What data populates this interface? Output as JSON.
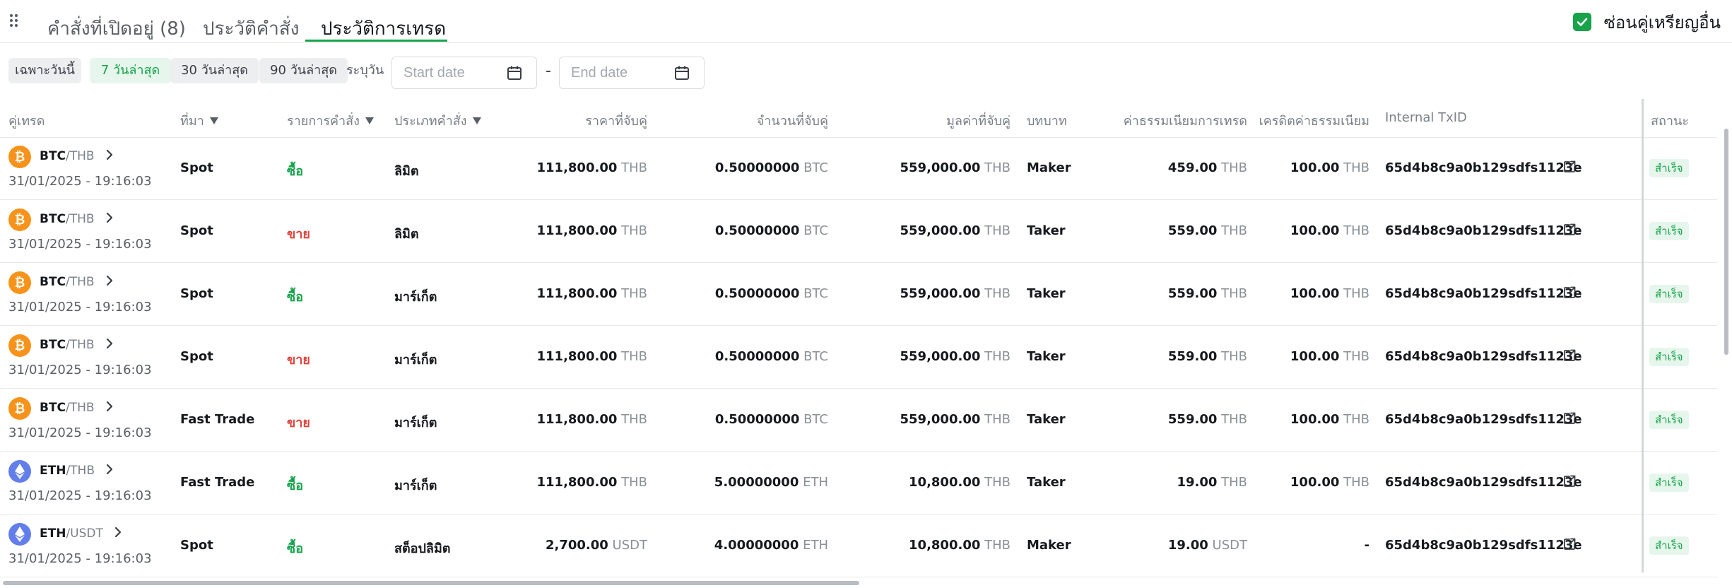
{
  "tabs": [
    {
      "label": "คำสั่งที่เปิดอยู่ (8)",
      "active": false
    },
    {
      "label": "ประวัติคำสั่ง",
      "active": false
    },
    {
      "label": "ประวัติการเทรด",
      "active": true
    }
  ],
  "hide_other_pairs": {
    "label": "ซ่อนคู่เหรียญอื่น",
    "checked": true
  },
  "filters": {
    "chips": [
      {
        "label": "เฉพาะวันนี้",
        "active": false
      },
      {
        "label": "7 วันล่าสุด",
        "active": true
      },
      {
        "label": "30 วันล่าสุด",
        "active": false
      },
      {
        "label": "90 วันล่าสุด",
        "active": false
      }
    ],
    "custom_label": "ระบุวัน",
    "start_placeholder": "Start date",
    "end_placeholder": "End date",
    "separator": "-"
  },
  "columns": {
    "pair": "คู่เทรด",
    "source": "ที่มา",
    "side": "รายการคำสั่ง",
    "type": "ประเภทคำสั่ง",
    "price": "ราคาที่จับคู่",
    "amount": "จำนวนที่จับคู่",
    "value": "มูลค่าที่จับคู่",
    "role": "บทบาท",
    "fee": "ค่าธรรมเนียมการเทรด",
    "fee_credit": "เครดิตค่าธรรมเนียม",
    "txid": "Internal TxID",
    "status": "สถานะ"
  },
  "rows": [
    {
      "coin": "btc",
      "base": "BTC",
      "quote": "/THB",
      "date": "31/01/2025 - 19:16:03",
      "source": "Spot",
      "side": "ซื้อ",
      "side_type": "buy",
      "order_type": "ลิมิต",
      "price": "111,800.00",
      "price_unit": "THB",
      "amount": "0.50000000",
      "amount_unit": "BTC",
      "value": "559,000.00",
      "value_unit": "THB",
      "role": "Maker",
      "fee": "459.00",
      "fee_unit": "THB",
      "credit": "100.00",
      "credit_unit": "THB",
      "txid": "65d4b8c9a0b129sdfs1123e",
      "status": "สำเร็จ"
    },
    {
      "coin": "btc",
      "base": "BTC",
      "quote": "/THB",
      "date": "31/01/2025 - 19:16:03",
      "source": "Spot",
      "side": "ขาย",
      "side_type": "sell",
      "order_type": "ลิมิต",
      "price": "111,800.00",
      "price_unit": "THB",
      "amount": "0.50000000",
      "amount_unit": "BTC",
      "value": "559,000.00",
      "value_unit": "THB",
      "role": "Taker",
      "fee": "559.00",
      "fee_unit": "THB",
      "credit": "100.00",
      "credit_unit": "THB",
      "txid": "65d4b8c9a0b129sdfs1123e",
      "status": "สำเร็จ"
    },
    {
      "coin": "btc",
      "base": "BTC",
      "quote": "/THB",
      "date": "31/01/2025 - 19:16:03",
      "source": "Spot",
      "side": "ซื้อ",
      "side_type": "buy",
      "order_type": "มาร์เก็ต",
      "price": "111,800.00",
      "price_unit": "THB",
      "amount": "0.50000000",
      "amount_unit": "BTC",
      "value": "559,000.00",
      "value_unit": "THB",
      "role": "Taker",
      "fee": "559.00",
      "fee_unit": "THB",
      "credit": "100.00",
      "credit_unit": "THB",
      "txid": "65d4b8c9a0b129sdfs1123e",
      "status": "สำเร็จ"
    },
    {
      "coin": "btc",
      "base": "BTC",
      "quote": "/THB",
      "date": "31/01/2025 - 19:16:03",
      "source": "Spot",
      "side": "ขาย",
      "side_type": "sell",
      "order_type": "มาร์เก็ต",
      "price": "111,800.00",
      "price_unit": "THB",
      "amount": "0.50000000",
      "amount_unit": "BTC",
      "value": "559,000.00",
      "value_unit": "THB",
      "role": "Taker",
      "fee": "559.00",
      "fee_unit": "THB",
      "credit": "100.00",
      "credit_unit": "THB",
      "txid": "65d4b8c9a0b129sdfs1123e",
      "status": "สำเร็จ"
    },
    {
      "coin": "btc",
      "base": "BTC",
      "quote": "/THB",
      "date": "31/01/2025 - 19:16:03",
      "source": "Fast Trade",
      "side": "ขาย",
      "side_type": "sell",
      "order_type": "มาร์เก็ต",
      "price": "111,800.00",
      "price_unit": "THB",
      "amount": "0.50000000",
      "amount_unit": "BTC",
      "value": "559,000.00",
      "value_unit": "THB",
      "role": "Taker",
      "fee": "559.00",
      "fee_unit": "THB",
      "credit": "100.00",
      "credit_unit": "THB",
      "txid": "65d4b8c9a0b129sdfs1123e",
      "status": "สำเร็จ"
    },
    {
      "coin": "eth",
      "base": "ETH",
      "quote": "/THB",
      "date": "31/01/2025 - 19:16:03",
      "source": "Fast Trade",
      "side": "ซื้อ",
      "side_type": "buy",
      "order_type": "มาร์เก็ต",
      "price": "111,800.00",
      "price_unit": "THB",
      "amount": "5.00000000",
      "amount_unit": "ETH",
      "value": "10,800.00",
      "value_unit": "THB",
      "role": "Taker",
      "fee": "19.00",
      "fee_unit": "THB",
      "credit": "100.00",
      "credit_unit": "THB",
      "txid": "65d4b8c9a0b129sdfs1123e",
      "status": "สำเร็จ"
    },
    {
      "coin": "eth",
      "base": "ETH",
      "quote": "/USDT",
      "date": "31/01/2025 - 19:16:03",
      "source": "Spot",
      "side": "ซื้อ",
      "side_type": "buy",
      "order_type": "สต็อปลิมิต",
      "price": "2,700.00",
      "price_unit": "USDT",
      "amount": "4.00000000",
      "amount_unit": "ETH",
      "value": "10,800.00",
      "value_unit": "THB",
      "role": "Maker",
      "fee": "19.00",
      "fee_unit": "USDT",
      "credit": "-",
      "credit_unit": "",
      "txid": "65d4b8c9a0b129sdfs1123e",
      "status": "สำเร็จ"
    }
  ],
  "colors": {
    "accent": "#16a34a",
    "sell": "#e0443e",
    "btc": "#f7931a",
    "eth": "#627eea"
  }
}
